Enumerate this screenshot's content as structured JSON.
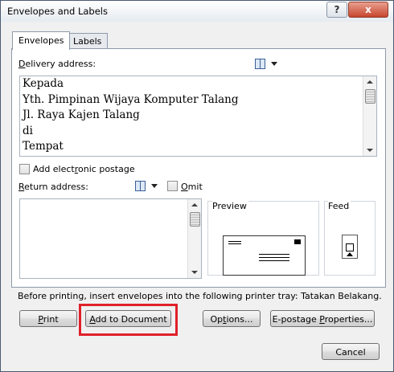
{
  "window": {
    "title": "Envelopes and Labels",
    "help_label": "?",
    "close_label": "x"
  },
  "tabs": [
    {
      "label": "Envelopes"
    },
    {
      "label": "Labels"
    }
  ],
  "delivery": {
    "label_u": "D",
    "label_rest": "elivery address:",
    "text": "Kepada\nYth. Pimpinan Wijaya Komputer Talang\nJl. Raya Kajen Talang\ndi\nTempat"
  },
  "postage": {
    "label_pre": "Add elect",
    "label_u": "r",
    "label_post": "onic postage",
    "checked": false
  },
  "return_address": {
    "label_u": "R",
    "label_rest": "eturn address:",
    "text": ""
  },
  "omit": {
    "label_u": "O",
    "label_rest": "mit",
    "checked": false
  },
  "preview": {
    "label": "Preview"
  },
  "feed": {
    "label": "Feed"
  },
  "printer_tray_note": "Before printing, insert envelopes into the following printer tray: Tatakan Belakang.",
  "buttons": {
    "print": {
      "u": "P",
      "rest": "rint"
    },
    "add_to_document": {
      "pre": "",
      "u": "A",
      "rest": "dd to Document"
    },
    "options": {
      "pre": "Op",
      "u": "t",
      "rest": "ions..."
    },
    "epostage": {
      "pre": "E-postage ",
      "u": "P",
      "rest": "roperties..."
    },
    "cancel": "Cancel"
  },
  "colors": {
    "highlight": "#e0202a",
    "border": "#8e9aaa"
  },
  "icons": [
    "address-book-icon",
    "dropdown-arrow-icon"
  ]
}
